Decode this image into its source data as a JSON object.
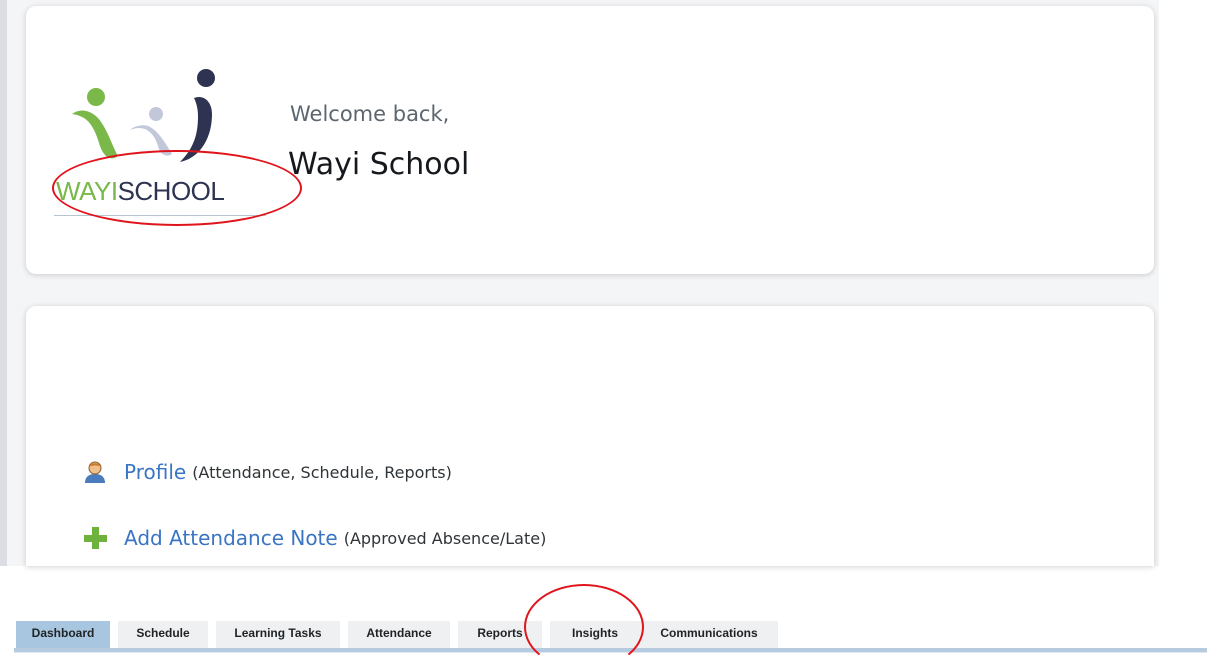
{
  "welcome": {
    "greeting": "Welcome back,",
    "name": "Wayi School"
  },
  "logo": {
    "text_part1": "WAYI",
    "text_part2": "SCHOOL",
    "colors": {
      "green": "#7ab84a",
      "navy": "#2d3350",
      "light": "#c3c7da"
    }
  },
  "links": [
    {
      "icon": "person-icon",
      "label": "Profile",
      "detail": "(Attendance, Schedule, Reports)"
    },
    {
      "icon": "plus-icon",
      "label": "Add Attendance Note",
      "detail": "(Approved Absence/Late)"
    }
  ],
  "tabs": [
    {
      "label": "Dashboard",
      "active": true
    },
    {
      "label": "Schedule",
      "active": false
    },
    {
      "label": "Learning Tasks",
      "active": false
    },
    {
      "label": "Attendance",
      "active": false
    },
    {
      "label": "Reports",
      "active": false
    },
    {
      "label": "Insights",
      "active": false
    },
    {
      "label": "Communications",
      "active": false
    }
  ],
  "colors": {
    "link": "#3a75c4",
    "annotation": "#e0141b",
    "tab_active": "#a9c6e0"
  }
}
